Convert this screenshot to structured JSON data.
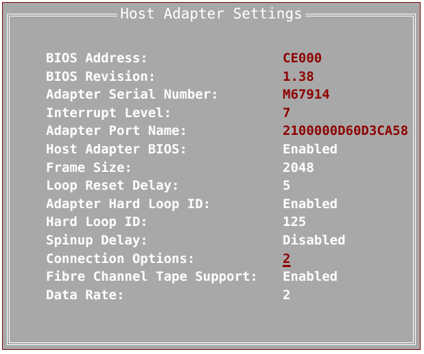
{
  "window": {
    "title": "Host Adapter Settings"
  },
  "colors": {
    "background": "#a8a8a8",
    "label_text": "#ffffff",
    "readonly_value_text": "#8e0000",
    "editable_value_text": "#ffffff",
    "selected_value_text": "#8e0000"
  },
  "settings": [
    {
      "label": "BIOS Address:",
      "value": "CE000"
    },
    {
      "label": "BIOS Revision:",
      "value": "1.38"
    },
    {
      "label": "Adapter Serial Number:",
      "value": "M67914"
    },
    {
      "label": "Interrupt Level:",
      "value": "7"
    },
    {
      "label": "Adapter Port Name:",
      "value": "2100000D60D3CA58"
    },
    {
      "label": "Host Adapter BIOS:",
      "value": "Enabled"
    },
    {
      "label": "Frame Size:",
      "value": "2048"
    },
    {
      "label": "Loop Reset Delay:",
      "value": "5"
    },
    {
      "label": "Adapter Hard Loop ID:",
      "value": "Enabled"
    },
    {
      "label": "Hard Loop ID:",
      "value": "125"
    },
    {
      "label": "Spinup Delay:",
      "value": "Disabled"
    },
    {
      "label": "Connection Options:",
      "value": "2"
    },
    {
      "label": "Fibre Channel Tape Support:",
      "value": "Enabled"
    },
    {
      "label": "Data Rate:",
      "value": "2"
    }
  ]
}
